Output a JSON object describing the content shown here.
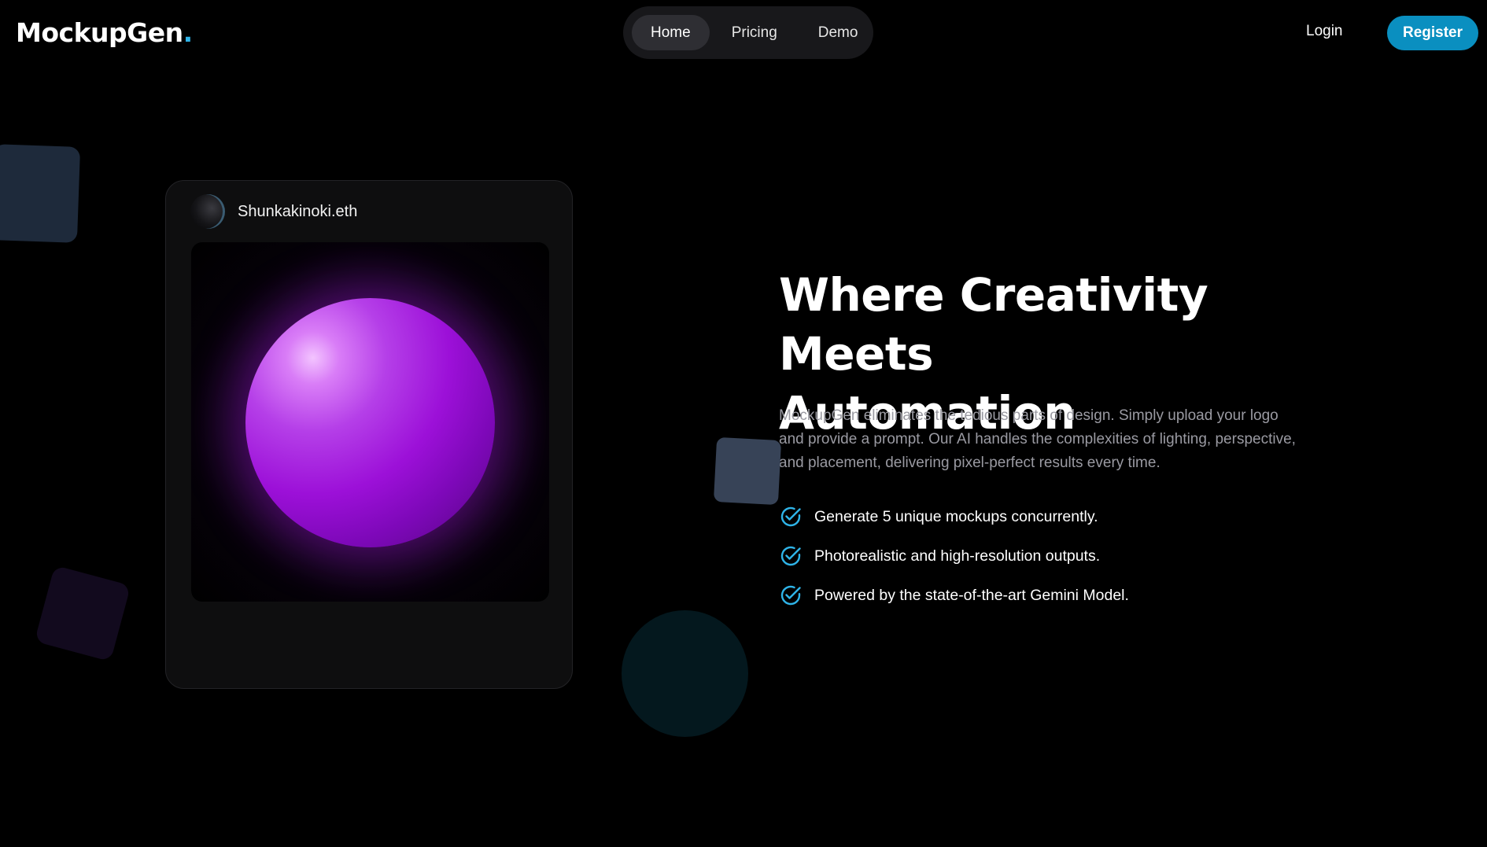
{
  "header": {
    "logo": {
      "text": "MockupGen",
      "dot": "."
    },
    "nav": [
      {
        "label": "Home",
        "active": true
      },
      {
        "label": "Pricing",
        "active": false
      },
      {
        "label": "Demo",
        "active": false
      }
    ],
    "login_label": "Login",
    "register_label": "Register"
  },
  "card": {
    "username": "Shunkakinoki.eth"
  },
  "hero": {
    "title_line1": "Where Creativity Meets",
    "title_line2": "Automation",
    "description": "MockupGen eliminates the tedious parts of design. Simply upload your logo and provide a prompt. Our AI handles the complexities of lighting, perspective, and placement, delivering pixel-perfect results every time.",
    "features": [
      "Generate 5 unique mockups concurrently.",
      "Photorealistic and high-resolution outputs.",
      "Powered by the state-of-the-art Gemini Model."
    ]
  },
  "colors": {
    "accent": "#0a8fc0",
    "logo_dot": "#2fb4e8",
    "check": "#2fb4e8",
    "orb": "#9c10d8"
  },
  "icons": {
    "feature_icon": "check-circle-icon"
  }
}
